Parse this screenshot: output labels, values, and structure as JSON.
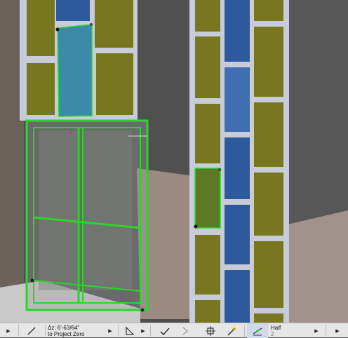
{
  "toolbar": {
    "delta_z": "Δz: 6'-63/64\"",
    "reference": "to Project Zero",
    "snap_label": "Half",
    "snap_value": "2"
  },
  "icons": {
    "line_tool": "diagonal-line-icon",
    "slope_tool": "slope-angle-icon",
    "check_tool": "checkmark-icon",
    "guide_tool": "guide-line-icon",
    "offset_tool": "offset-frame-icon",
    "magic_wand": "magic-wand-icon",
    "snap_tool": "snap-guide-icon",
    "dropdown": "dropdown-arrow-icon"
  },
  "colors": {
    "selection": "#2bd62b",
    "glass_yellow": "#77771f",
    "glass_blue": "#2c5a9c",
    "frame": "#c8ccd8",
    "toolbar_bg": "#e6e6e6"
  }
}
